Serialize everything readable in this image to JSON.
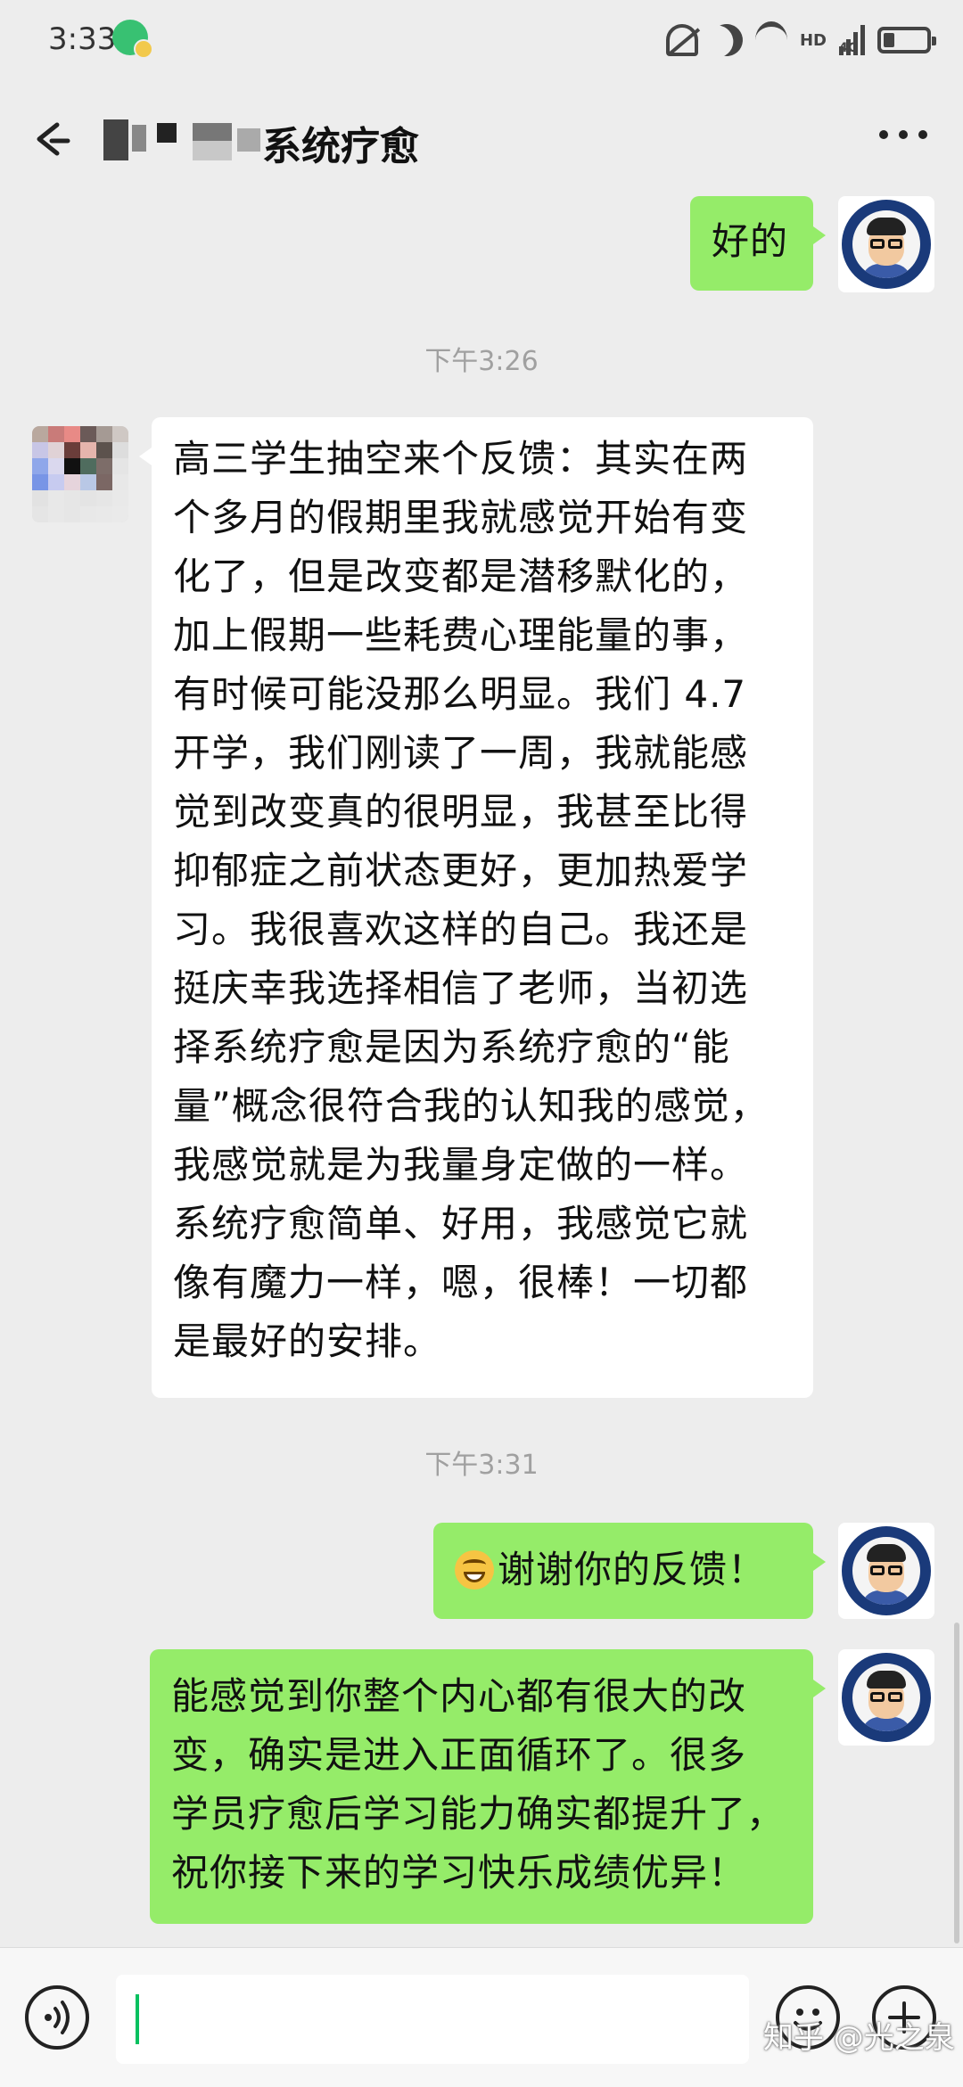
{
  "status_bar": {
    "time": "3:33",
    "network_label": "4G",
    "hd_label": "HD"
  },
  "nav": {
    "title": "系统疗愈"
  },
  "messages": [
    {
      "side": "me",
      "text": "好的"
    },
    {
      "type": "time",
      "text": "下午3:26"
    },
    {
      "side": "other",
      "lines": [
        "高三学生抽空来个反馈：其实在两",
        "个多月的假期里我就感觉开始有变",
        "化了，但是改变都是潜移默化的，",
        "加上假期一些耗费心理能量的事，",
        "有时候可能没那么明显。我们 4.7",
        "开学，我们刚读了一周，我就能感",
        "觉到改变真的很明显，我甚至比得",
        "抑郁症之前状态更好，更加热爱学",
        "习。我很喜欢这样的自己。我还是",
        "挺庆幸我选择相信了老师，当初选",
        "择系统疗愈是因为系统疗愈的“能",
        "量”概念很符合我的认知我的感觉，",
        "我感觉就是为我量身定做的一样。",
        "系统疗愈简单、好用，我感觉它就",
        "像有魔力一样，嗯，很棒！一切都",
        "是最好的安排。"
      ]
    },
    {
      "type": "time",
      "text": "下午3:31"
    },
    {
      "side": "me",
      "emoji": "grinning-face",
      "text": "谢谢你的反馈！"
    },
    {
      "side": "me",
      "lines": [
        "能感觉到你整个内心都有很大的改",
        "变，确实是进入正面循环了。很多",
        "学员疗愈后学习能力确实都提升了，",
        "祝你接下来的学习快乐成绩优异！"
      ]
    }
  ],
  "input": {
    "text": ""
  },
  "watermark": "知乎 @光之泉",
  "colors": {
    "sent_bubble": "#95ec69",
    "received_bubble": "#ffffff",
    "background": "#ededed",
    "caret": "#07c160"
  }
}
